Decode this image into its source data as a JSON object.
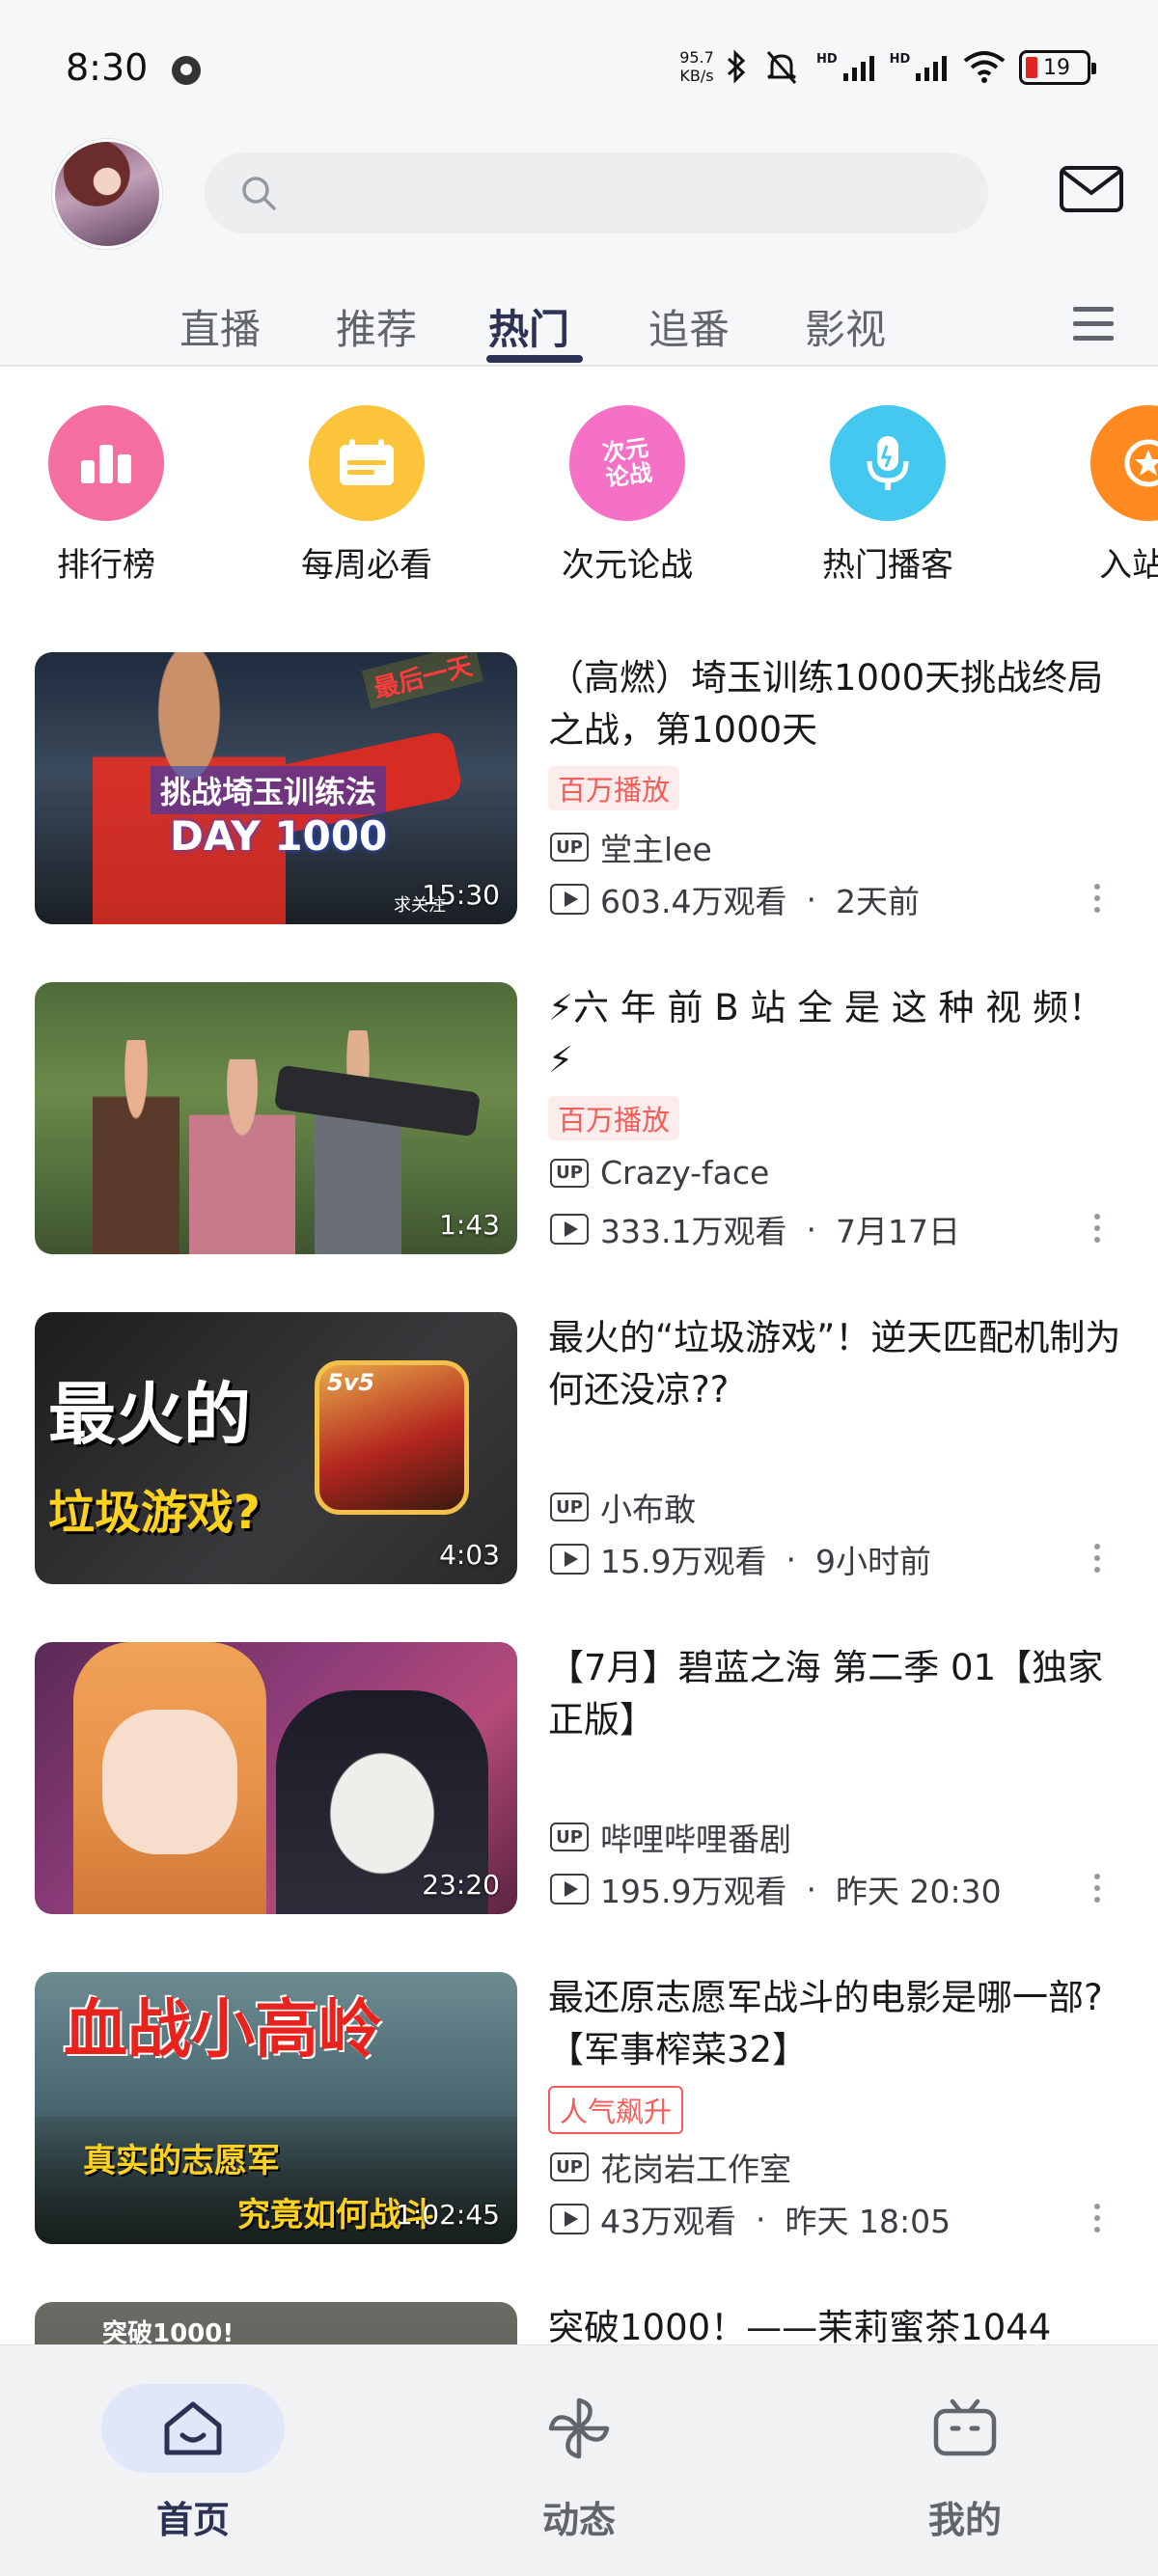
{
  "status_bar": {
    "time": "8:30",
    "net_speed_value": "95.7",
    "net_speed_unit": "KB/s",
    "signal1_label": "HD",
    "signal2_label": "HD",
    "battery": "19"
  },
  "header": {
    "search_placeholder": "",
    "tabs": [
      {
        "label": "直播"
      },
      {
        "label": "推荐"
      },
      {
        "label": "热门"
      },
      {
        "label": "追番"
      },
      {
        "label": "影视"
      }
    ],
    "active_tab": "热门"
  },
  "quick_entries": [
    {
      "label": "排行榜",
      "color": "#f46fa0",
      "glyph": "bars"
    },
    {
      "label": "每周必看",
      "color": "#fbc43a",
      "glyph": "calendar"
    },
    {
      "label": "次元论战",
      "color": "#f471c5",
      "glyph_text": "次元\n论战"
    },
    {
      "label": "热门播客",
      "color": "#45c8ef",
      "glyph": "mic"
    },
    {
      "label": "入站必",
      "color": "#ff8a1f",
      "glyph": "star"
    }
  ],
  "videos": [
    {
      "title": "（高燃）埼玉训练1000天挑战终局之战，第1000天",
      "badge": "百万播放",
      "badge_style": "soft",
      "uploader": "堂主lee",
      "views": "603.4万观看",
      "time": "2天前",
      "duration": "15:30",
      "thumb_text1": "挑战埼玉训练法",
      "thumb_text2": "DAY 1000",
      "thumb_text3": "最后一天",
      "thumb_text4": "求关注"
    },
    {
      "title": "⚡六 年 前 B 站 全 是 这 种 视 频！⚡",
      "badge": "百万播放",
      "badge_style": "soft",
      "uploader": "Crazy-face",
      "views": "333.1万观看",
      "time": "7月17日",
      "duration": "1:43"
    },
    {
      "title": "最火的“垃圾游戏”！逆天匹配机制为何还没凉??",
      "badge": "",
      "uploader": "小布敢",
      "views": "15.9万观看",
      "time": "9小时前",
      "duration": "4:03",
      "thumb_text1": "最火的",
      "thumb_text2": "垃圾游戏?",
      "thumb_text3": "5v5"
    },
    {
      "title": "【7月】碧蓝之海 第二季 01【独家正版】",
      "badge": "",
      "uploader": "哔哩哔哩番剧",
      "views": "195.9万观看",
      "time": "昨天 20:30",
      "duration": "23:20"
    },
    {
      "title": "最还原志愿军战斗的电影是哪一部?【军事榨菜32】",
      "badge": "人气飙升",
      "badge_style": "outline",
      "uploader": "花岗岩工作室",
      "views": "43万观看",
      "time": "昨天 18:05",
      "duration": "1:02:45",
      "thumb_text1": "血战小高岭",
      "thumb_text2": "真实的志愿军",
      "thumb_text3": "究竟如何战斗"
    },
    {
      "title": "突破1000！——茉莉蜜茶1044",
      "thumb_text1": "突破1000!"
    }
  ],
  "up_tag": "UP",
  "separator": "·",
  "bottom_nav": [
    {
      "label": "首页",
      "active": true
    },
    {
      "label": "动态",
      "active": false
    },
    {
      "label": "我的",
      "active": false
    }
  ],
  "colors": {
    "accent": "#2b3253",
    "badge_red": "#f25d59",
    "nav_active_bg": "#e2e6f9"
  }
}
